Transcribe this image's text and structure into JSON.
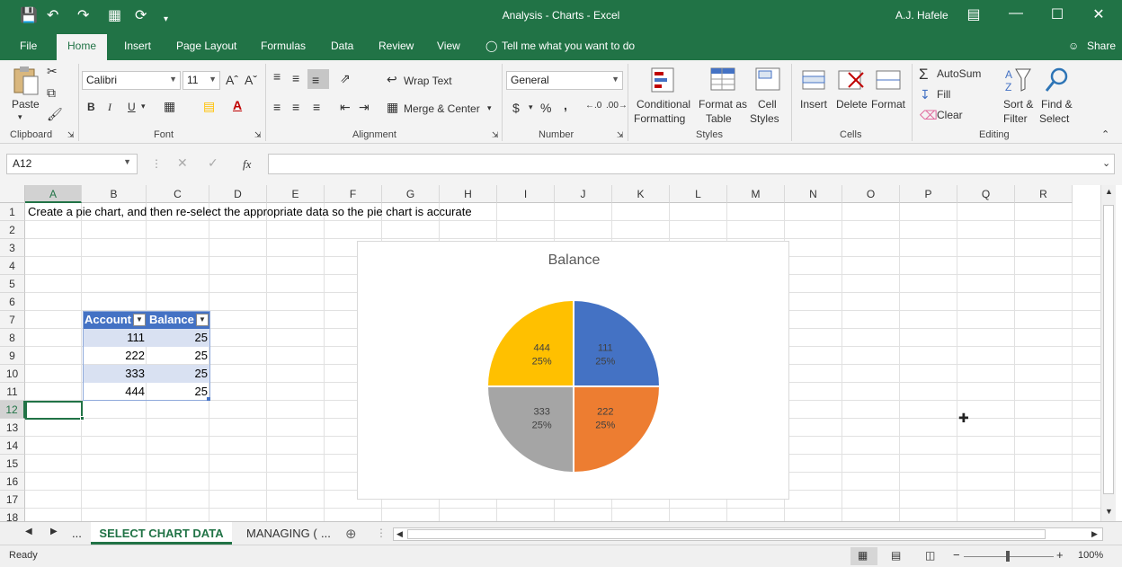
{
  "window": {
    "title": "Analysis - Charts  -  Excel",
    "user": "A.J. Hafele"
  },
  "tabs": [
    "File",
    "Home",
    "Insert",
    "Page Layout",
    "Formulas",
    "Data",
    "Review",
    "View"
  ],
  "tell_me": "Tell me what you want to do",
  "share": "Share",
  "ribbon": {
    "clipboard": {
      "label": "Clipboard",
      "paste": "Paste"
    },
    "font": {
      "label": "Font",
      "name": "Calibri",
      "size": "11",
      "bold": "B",
      "italic": "I",
      "underline": "U"
    },
    "alignment": {
      "label": "Alignment",
      "wrap": "Wrap Text",
      "merge": "Merge & Center"
    },
    "number": {
      "label": "Number",
      "format": "General",
      "currency": "$",
      "percent": "%",
      "comma": ","
    },
    "styles": {
      "label": "Styles",
      "conditional1": "Conditional",
      "conditional2": "Formatting",
      "format_as1": "Format as",
      "format_as2": "Table",
      "cell1": "Cell",
      "cell2": "Styles"
    },
    "cells": {
      "label": "Cells",
      "insert": "Insert",
      "delete": "Delete",
      "format": "Format"
    },
    "editing": {
      "label": "Editing",
      "autosum": "AutoSum",
      "fill": "Fill",
      "clear": "Clear",
      "sort1": "Sort &",
      "sort2": "Filter",
      "find1": "Find &",
      "find2": "Select"
    }
  },
  "formula_bar": {
    "name_box": "A12",
    "fx": "fx",
    "formula": ""
  },
  "columns": [
    "A",
    "B",
    "C",
    "D",
    "E",
    "F",
    "G",
    "H",
    "I",
    "J",
    "K",
    "L",
    "M",
    "N",
    "O",
    "P",
    "Q",
    "R"
  ],
  "rows": [
    "1",
    "2",
    "3",
    "4",
    "5",
    "6",
    "7",
    "8",
    "9",
    "10",
    "11",
    "12",
    "13",
    "14",
    "15",
    "16",
    "17",
    "18"
  ],
  "sheet": {
    "a1": "Create a pie chart, and then re-select the appropriate data so the pie chart is accurate",
    "table": {
      "headers": [
        "Account",
        "Balance"
      ],
      "rows": [
        [
          "111",
          "25"
        ],
        [
          "222",
          "25"
        ],
        [
          "333",
          "25"
        ],
        [
          "444",
          "25"
        ]
      ]
    }
  },
  "chart_data": {
    "type": "pie",
    "title": "Balance",
    "categories": [
      "111",
      "222",
      "333",
      "444"
    ],
    "values": [
      25,
      25,
      25,
      25
    ],
    "percent_labels": [
      "25%",
      "25%",
      "25%",
      "25%"
    ],
    "colors": [
      "#4472c4",
      "#ed7d31",
      "#a5a5a5",
      "#ffc000"
    ]
  },
  "sheet_tabs": {
    "nav_more": "...",
    "active": "SELECT CHART DATA",
    "other": "MANAGING (",
    "more": "..."
  },
  "status": {
    "ready": "Ready",
    "zoom": "100%"
  }
}
